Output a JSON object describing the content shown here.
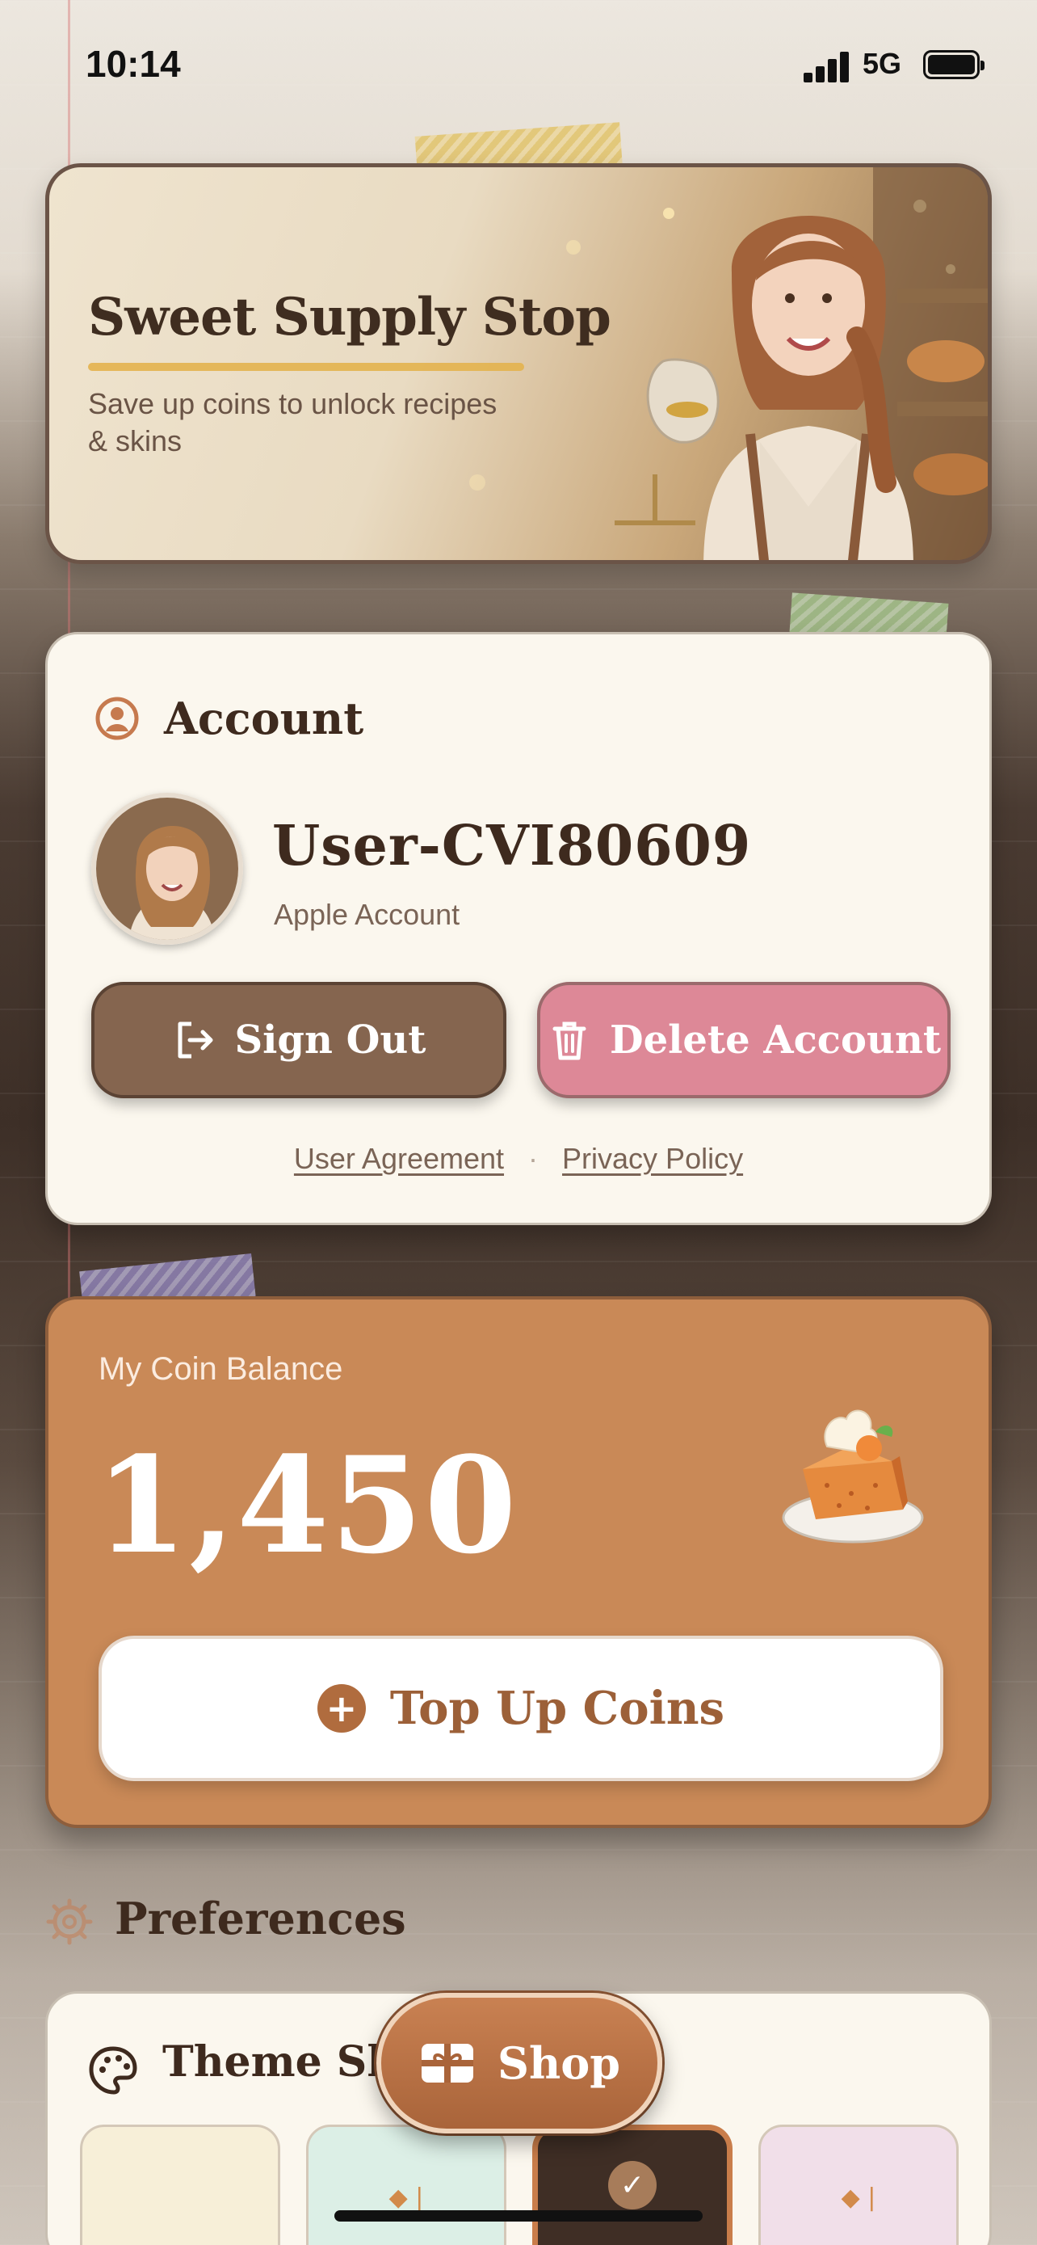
{
  "status_bar": {
    "time": "10:14",
    "network": "5G"
  },
  "hero": {
    "title": "Sweet Supply Stop",
    "subtitle": "Save up coins to unlock recipes & skins"
  },
  "account": {
    "title": "Account",
    "username": "User-CVI80609",
    "account_type": "Apple Account",
    "sign_out_label": "Sign Out",
    "delete_label": "Delete Account",
    "links": {
      "agreement": "User Agreement",
      "separator": "·",
      "privacy": "Privacy Policy"
    }
  },
  "coins": {
    "label": "My Coin Balance",
    "balance": "1,450",
    "top_up_label": "Top Up Coins",
    "top_up_icon": "plus-icon"
  },
  "preferences": {
    "title": "Preferences",
    "theme": {
      "title": "Theme Skin",
      "swatches": [
        {
          "name": "cream",
          "color": "#f7efd8",
          "selected": false
        },
        {
          "name": "mint",
          "color": "#dcefe6",
          "selected": false
        },
        {
          "name": "cocoa",
          "color": "#3f2e25",
          "selected": true
        },
        {
          "name": "rose",
          "color": "#f1dfe9",
          "selected": false
        }
      ]
    }
  },
  "nav": {
    "shop_label": "Shop",
    "shop_icon": "gift-icon"
  },
  "colors": {
    "accent": "#c98957",
    "sign_out": "#85654f",
    "delete": "#dd8897",
    "text_dark": "#3e2a1e"
  }
}
